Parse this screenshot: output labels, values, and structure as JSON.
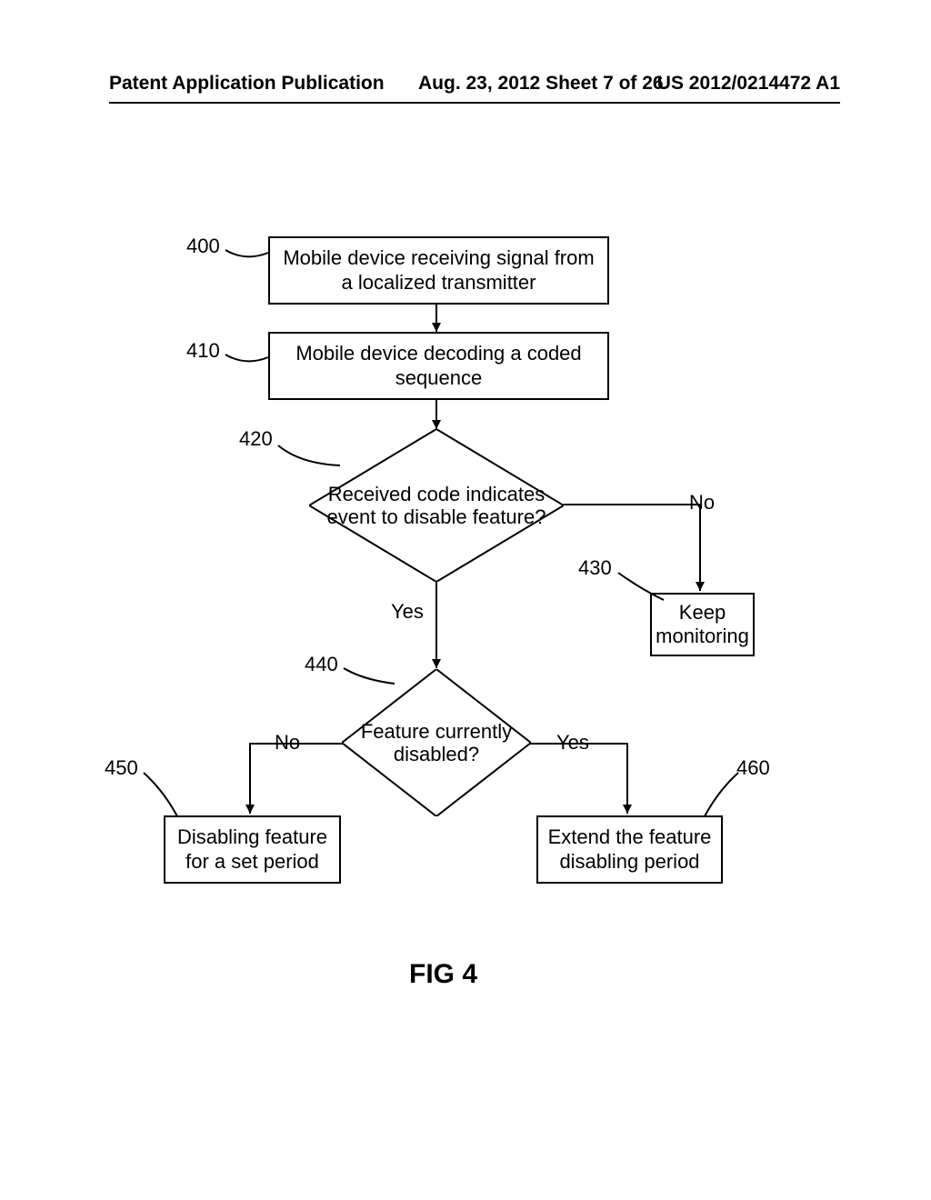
{
  "header": {
    "left": "Patent Application Publication",
    "center": "Aug. 23, 2012  Sheet 7 of 26",
    "right": "US 2012/0214472 A1"
  },
  "nodes": {
    "n400": {
      "ref": "400",
      "text": "Mobile device receiving signal from a localized transmitter"
    },
    "n410": {
      "ref": "410",
      "text": "Mobile device decoding a coded sequence"
    },
    "n420": {
      "ref": "420",
      "text": "Received code indicates event to disable feature?"
    },
    "n430": {
      "ref": "430",
      "text": "Keep monitoring"
    },
    "n440": {
      "ref": "440",
      "text": "Feature currently disabled?"
    },
    "n450": {
      "ref": "450",
      "text": "Disabling feature for a set period"
    },
    "n460": {
      "ref": "460",
      "text": "Extend the feature disabling period"
    }
  },
  "edges": {
    "yes": "Yes",
    "no": "No"
  },
  "figure_label": "FIG 4",
  "chart_data": {
    "type": "flowchart",
    "title": "FIG 4",
    "nodes": [
      {
        "id": "400",
        "shape": "process",
        "text": "Mobile device receiving signal from a localized transmitter"
      },
      {
        "id": "410",
        "shape": "process",
        "text": "Mobile device decoding a coded sequence"
      },
      {
        "id": "420",
        "shape": "decision",
        "text": "Received code indicates event to disable feature?"
      },
      {
        "id": "430",
        "shape": "process",
        "text": "Keep monitoring"
      },
      {
        "id": "440",
        "shape": "decision",
        "text": "Feature currently disabled?"
      },
      {
        "id": "450",
        "shape": "process",
        "text": "Disabling feature for a set period"
      },
      {
        "id": "460",
        "shape": "process",
        "text": "Extend the feature disabling period"
      }
    ],
    "edges": [
      {
        "from": "400",
        "to": "410",
        "label": ""
      },
      {
        "from": "410",
        "to": "420",
        "label": ""
      },
      {
        "from": "420",
        "to": "430",
        "label": "No"
      },
      {
        "from": "420",
        "to": "440",
        "label": "Yes"
      },
      {
        "from": "440",
        "to": "450",
        "label": "No"
      },
      {
        "from": "440",
        "to": "460",
        "label": "Yes"
      }
    ]
  }
}
